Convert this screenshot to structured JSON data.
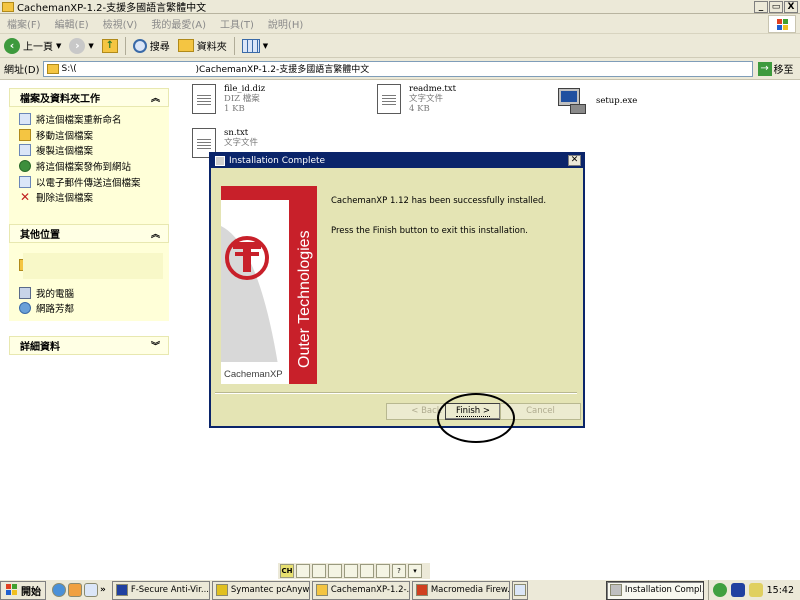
{
  "window": {
    "title": "CachemanXP-1.2-支援多國語言繁體中文",
    "controls": [
      "_",
      "▭",
      "X"
    ]
  },
  "menu": {
    "items": [
      "檔案(F)",
      "編輯(E)",
      "檢視(V)",
      "我的最愛(A)",
      "工具(T)",
      "說明(H)"
    ]
  },
  "toolbar": {
    "back_label": "上一頁",
    "search_label": "搜尋",
    "folders_label": "資料夾"
  },
  "address": {
    "label": "網址(D)",
    "value_left": "S:\\(",
    "value_right": ")CachemanXP-1.2-支援多國語言繁體中文",
    "go_label": "移至"
  },
  "tasks_panel": {
    "title": "檔案及資料夾工作",
    "items": [
      {
        "label": "將這個檔案重新命名",
        "icon": "rename-icon"
      },
      {
        "label": "移動這個檔案",
        "icon": "move-icon"
      },
      {
        "label": "複製這個檔案",
        "icon": "copy-icon"
      },
      {
        "label": "將這個檔案發佈到網站",
        "icon": "globe-icon"
      },
      {
        "label": "以電子郵件傳送這個檔案",
        "icon": "email-icon"
      },
      {
        "label": "刪除這個檔案",
        "icon": "delete-icon"
      }
    ]
  },
  "places_panel": {
    "title": "其他位置",
    "items": [
      {
        "label": "我的電腦",
        "icon": "my-computer-icon"
      },
      {
        "label": "網路芳鄰",
        "icon": "network-icon"
      }
    ]
  },
  "details_panel": {
    "title": "詳細資料"
  },
  "files": [
    {
      "name": "file_id.diz",
      "type": "DIZ 檔案",
      "size": "1 KB"
    },
    {
      "name": "readme.txt",
      "type": "文字文件",
      "size": "4 KB"
    },
    {
      "name": "setup.exe"
    },
    {
      "name": "sn.txt",
      "type": "文字文件"
    }
  ],
  "dialog": {
    "title": "Installation Complete",
    "message_line1": "CachemanXP 1.12 has been successfully installed.",
    "message_line2": "Press the Finish button to exit this installation.",
    "banner_brand": "Outer Technologies",
    "banner_product": "CachemanXP",
    "back_label": "< Back",
    "finish_label": "Finish >",
    "cancel_label": "Cancel"
  },
  "language_bar": {
    "lang": "CH"
  },
  "taskbar": {
    "start_label": "開始",
    "buttons": [
      {
        "label": "F-Secure Anti-Vir..."
      },
      {
        "label": "Symantec pcAnyw..."
      },
      {
        "label": "CachemanXP-1.2-..."
      },
      {
        "label": "Macromedia Firew..."
      },
      {
        "label": "Installation Compl...",
        "active": true
      }
    ],
    "clock": "15:42"
  },
  "colors": {
    "dialog_title_bg": "#0a246a",
    "dialog_body_bg": "#e4e4b4",
    "task_pane_bg": "#ffffd8",
    "banner_red": "#c8202a"
  }
}
